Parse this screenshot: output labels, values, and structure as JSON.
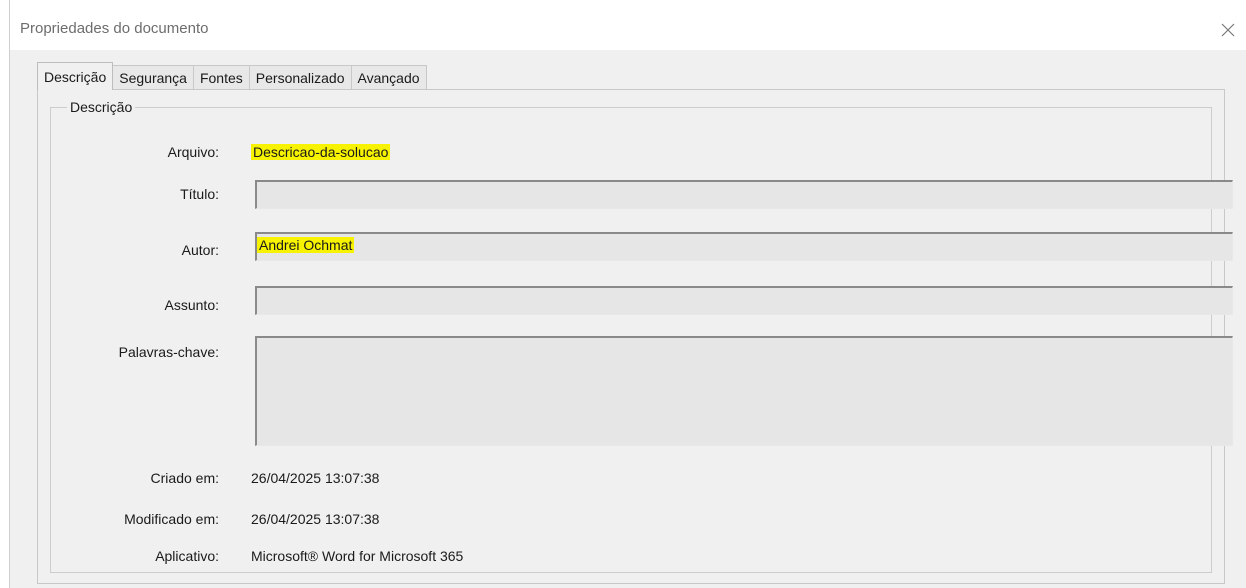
{
  "window": {
    "title": "Propriedades do documento",
    "close_icon": "close-icon"
  },
  "tabs": [
    {
      "label": "Descrição",
      "active": true
    },
    {
      "label": "Segurança",
      "active": false
    },
    {
      "label": "Fontes",
      "active": false
    },
    {
      "label": "Personalizado",
      "active": false
    },
    {
      "label": "Avançado",
      "active": false
    }
  ],
  "group": {
    "legend": "Descrição"
  },
  "fields": {
    "arquivo": {
      "label": "Arquivo:",
      "value": "Descricao-da-solucao"
    },
    "titulo": {
      "label": "Título:",
      "value": ""
    },
    "autor": {
      "label": "Autor:",
      "value": "Andrei Ochmat"
    },
    "assunto": {
      "label": "Assunto:",
      "value": ""
    },
    "palavras": {
      "label": "Palavras-chave:",
      "value": ""
    },
    "criado": {
      "label": "Criado em:",
      "value": "26/04/2025 13:07:38"
    },
    "modificado": {
      "label": "Modificado em:",
      "value": "26/04/2025 13:07:38"
    },
    "aplicativo": {
      "label": "Aplicativo:",
      "value": "Microsoft® Word for Microsoft 365"
    }
  },
  "colors": {
    "highlight": "#f6f200",
    "dialog_bg": "#f0f0f0",
    "field_bg": "#e6e6e6"
  }
}
